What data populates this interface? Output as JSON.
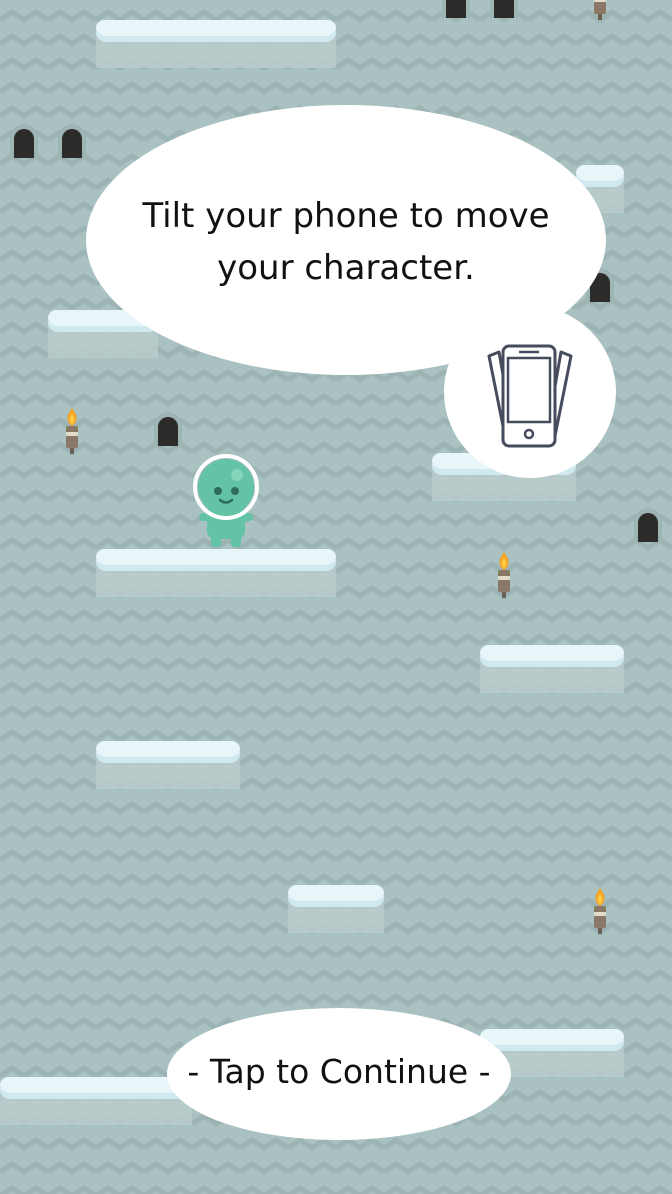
{
  "tutorial": {
    "message": "Tilt your phone to move your character.",
    "continue_label": "- Tap to Continue -"
  },
  "icons": {
    "phone": "tilt-phone-icon",
    "character": "alien-character",
    "torch": "torch-icon",
    "hole": "arch-doorway"
  },
  "colors": {
    "background": "#a9c1c1",
    "ice": "#e8f6f9",
    "character": "#62c3a6",
    "bubble": "#ffffff"
  }
}
